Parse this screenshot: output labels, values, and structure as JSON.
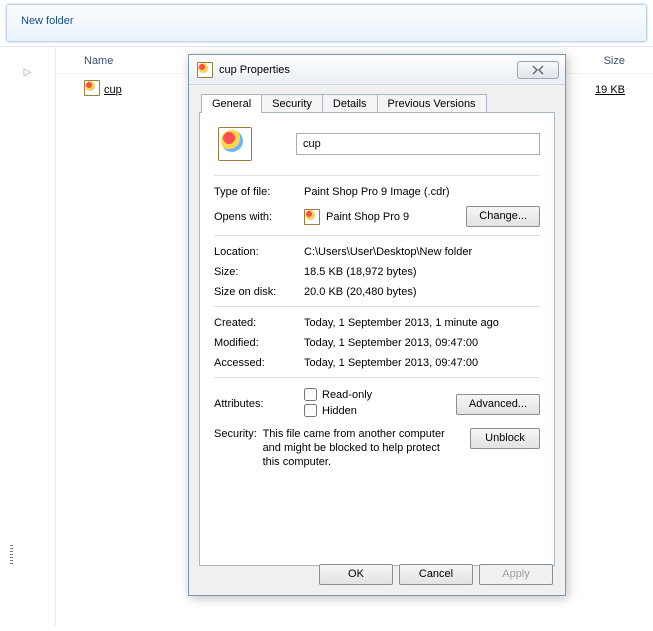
{
  "toolbar": {
    "new_folder": "New folder"
  },
  "columns": {
    "name": "Name",
    "size": "Size"
  },
  "file": {
    "name": "cup",
    "size": "19 KB"
  },
  "dialog": {
    "title": "cup Properties",
    "tabs": {
      "general": "General",
      "security": "Security",
      "details": "Details",
      "previous": "Previous Versions"
    },
    "filename": "cup",
    "labels": {
      "type": "Type of file:",
      "opens": "Opens with:",
      "location": "Location:",
      "size": "Size:",
      "disk": "Size on disk:",
      "created": "Created:",
      "modified": "Modified:",
      "accessed": "Accessed:",
      "attributes": "Attributes:",
      "security": "Security:"
    },
    "values": {
      "type": "Paint Shop Pro 9 Image (.cdr)",
      "opens": "Paint Shop Pro 9",
      "location": "C:\\Users\\User\\Desktop\\New folder",
      "size": "18.5 KB (18,972 bytes)",
      "disk": "20.0 KB (20,480 bytes)",
      "created": "Today, 1 September 2013, 1 minute ago",
      "modified": "Today, 1 September 2013, 09:47:00",
      "accessed": "Today, 1 September 2013, 09:47:00"
    },
    "attr": {
      "readonly": "Read-only",
      "hidden": "Hidden"
    },
    "security_text": "This file came from another computer and might be blocked to help protect this computer.",
    "buttons": {
      "change": "Change...",
      "advanced": "Advanced...",
      "unblock": "Unblock",
      "ok": "OK",
      "cancel": "Cancel",
      "apply": "Apply"
    }
  }
}
